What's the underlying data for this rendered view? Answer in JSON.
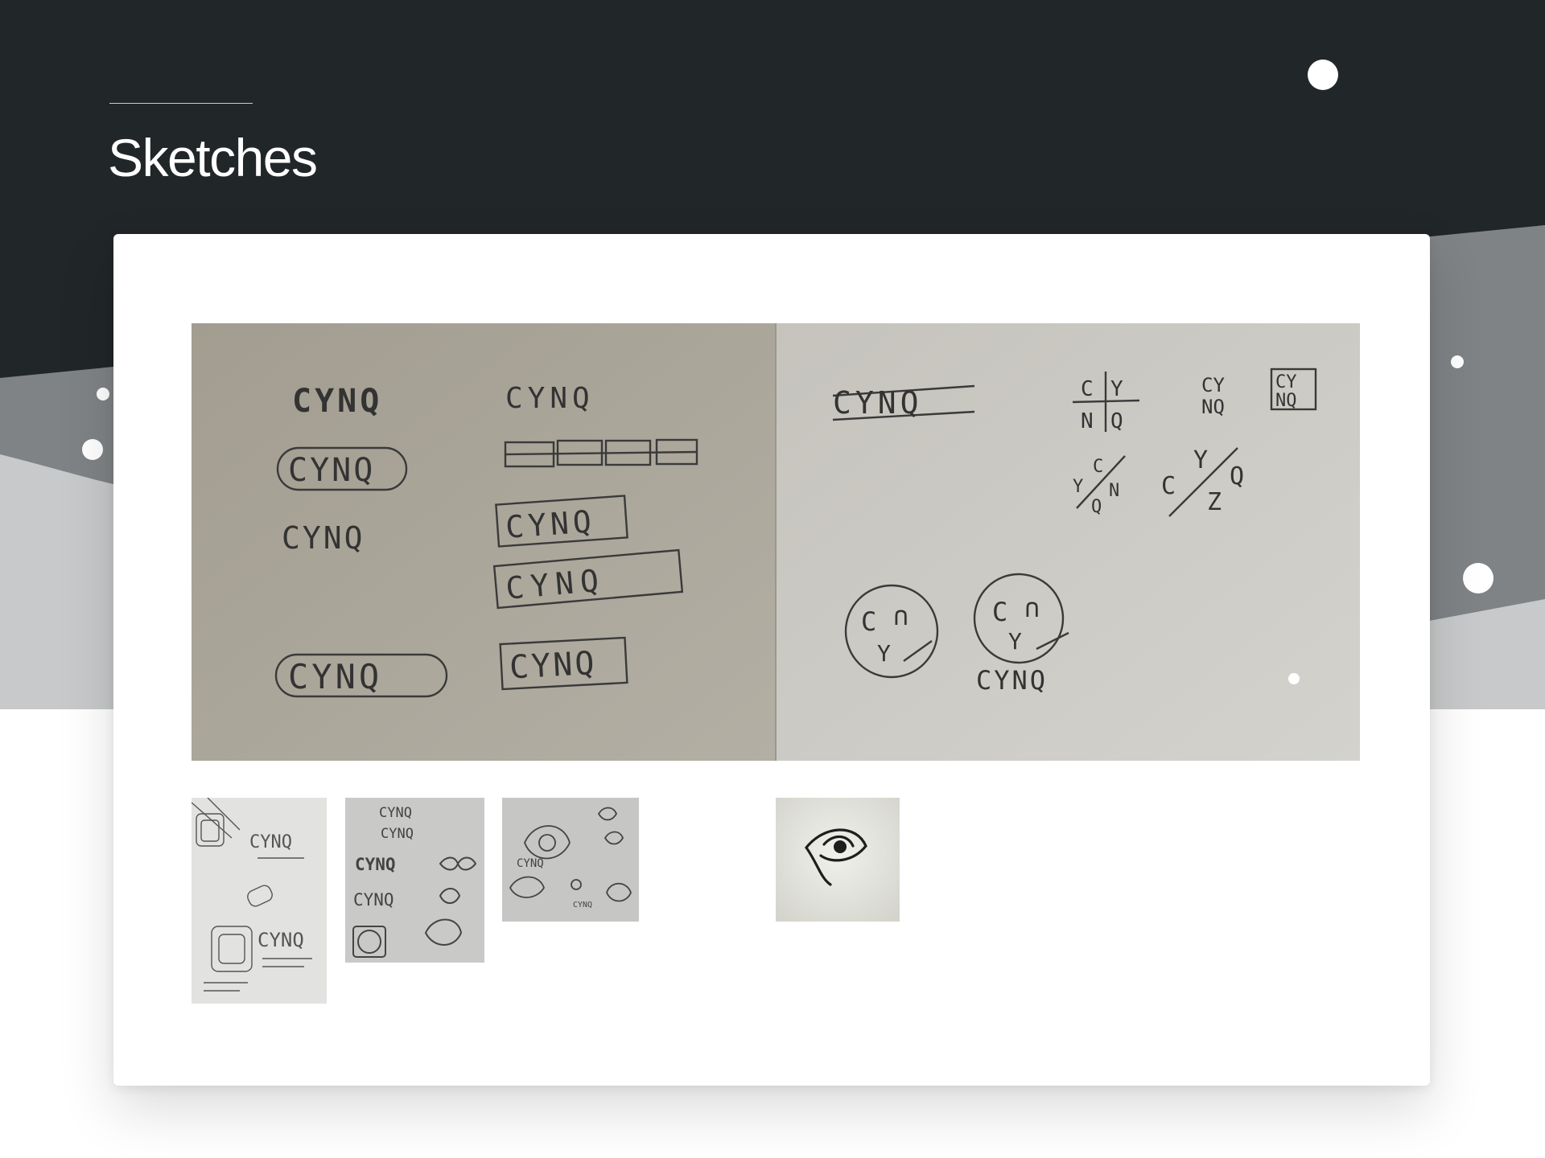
{
  "header": {
    "title": "Sketches"
  },
  "colors": {
    "dark_band": "#212628",
    "mid_gray": "#7f8385",
    "light_gray": "#c7c9ca",
    "paper_left": "#aaa598",
    "paper_right": "#c7c6c0",
    "pencil": "#3a3a3a"
  },
  "gallery": {
    "hero_alt": "Hand-drawn CYNQ logo sketches on paper",
    "thumbnails": [
      {
        "name": "sketch-page-monogram"
      },
      {
        "name": "sketch-page-wordmarks"
      },
      {
        "name": "sketch-page-eye-concepts"
      },
      {
        "name": "eye-symbol-final"
      }
    ]
  }
}
